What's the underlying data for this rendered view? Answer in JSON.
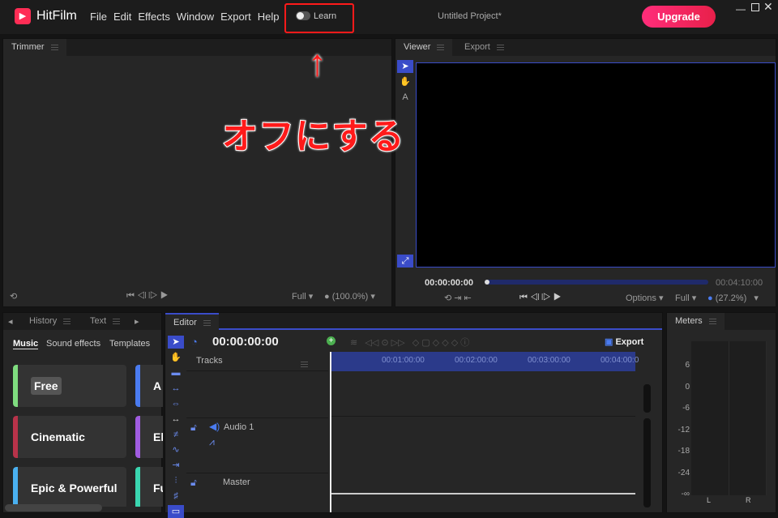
{
  "app": {
    "name": "HitFilm",
    "project_title": "Untitled Project*",
    "upgrade": "Upgrade",
    "learn": "Learn",
    "learn_on": false
  },
  "menu": [
    "File",
    "Edit",
    "Effects",
    "Window",
    "Export",
    "Help"
  ],
  "annotation": {
    "text": "オフにする",
    "arrow": "↑",
    "color": "#ff1a1a"
  },
  "trimmer": {
    "tab": "Trimmer",
    "quality": "Full",
    "zoom": "(100.0%)"
  },
  "viewer": {
    "tabs": [
      "Viewer",
      "Export"
    ],
    "current_time": "00:00:00:00",
    "end_time": "00:04:10:00",
    "options": "Options",
    "quality": "Full",
    "zoom": "(27.2%)"
  },
  "media": {
    "tabs": [
      "History",
      "Text"
    ],
    "subtabs": [
      "Music",
      "Sound effects",
      "Templates"
    ],
    "cards": [
      {
        "label": "Free",
        "color": "#7fdc7f"
      },
      {
        "label": "A",
        "color": "#4a7bf0"
      },
      {
        "label": "Cinematic",
        "color": "#b8334a"
      },
      {
        "label": "El",
        "color": "#a05ce0"
      },
      {
        "label": "Epic & Powerful",
        "color": "#4ab0f0"
      },
      {
        "label": "Fu",
        "color": "#3ad6b0"
      }
    ]
  },
  "editor": {
    "tab": "Editor",
    "timecode": "00:00:00:00",
    "tracks_label": "Tracks",
    "export": "Export",
    "ruler": [
      "00:01:00:00",
      "00:02:00:00",
      "00:03:00:00",
      "00:04:00:0"
    ],
    "tracks": [
      "Audio 1",
      "Master"
    ]
  },
  "meters": {
    "tab": "Meters",
    "scale": [
      "6",
      "0",
      "-6",
      "-12",
      "-18",
      "-24",
      "-∞"
    ],
    "channels": [
      "L",
      "R"
    ]
  },
  "colors": {
    "accent": "#3a4cc9",
    "upgrade_start": "#ff2d7a",
    "upgrade_end": "#e8204a"
  }
}
